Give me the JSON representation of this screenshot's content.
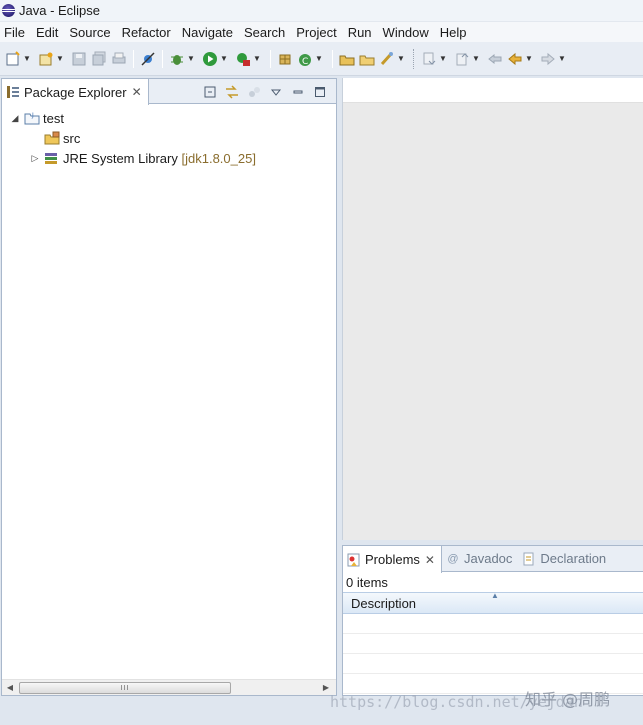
{
  "window": {
    "title": "Java - Eclipse"
  },
  "menu": [
    "File",
    "Edit",
    "Source",
    "Refactor",
    "Navigate",
    "Search",
    "Project",
    "Run",
    "Window",
    "Help"
  ],
  "package_explorer": {
    "tab_label": "Package Explorer",
    "tree": {
      "project": "test",
      "src": "src",
      "library_name": "JRE System Library",
      "library_suffix": "[jdk1.8.0_25]"
    }
  },
  "bottom_panel": {
    "tabs": {
      "problems": "Problems",
      "javadoc": "Javadoc",
      "declaration": "Declaration"
    },
    "items_count": "0 items",
    "columns": [
      "Description"
    ]
  },
  "watermark": {
    "url": "https://blog.csdn.net/yejdan",
    "zhihu": "知乎 @周鹏"
  },
  "colors": {
    "accent": "#a9b8cc",
    "toolbar_bg": "#e8edf4",
    "library_suffix": "#8a6d2e"
  }
}
